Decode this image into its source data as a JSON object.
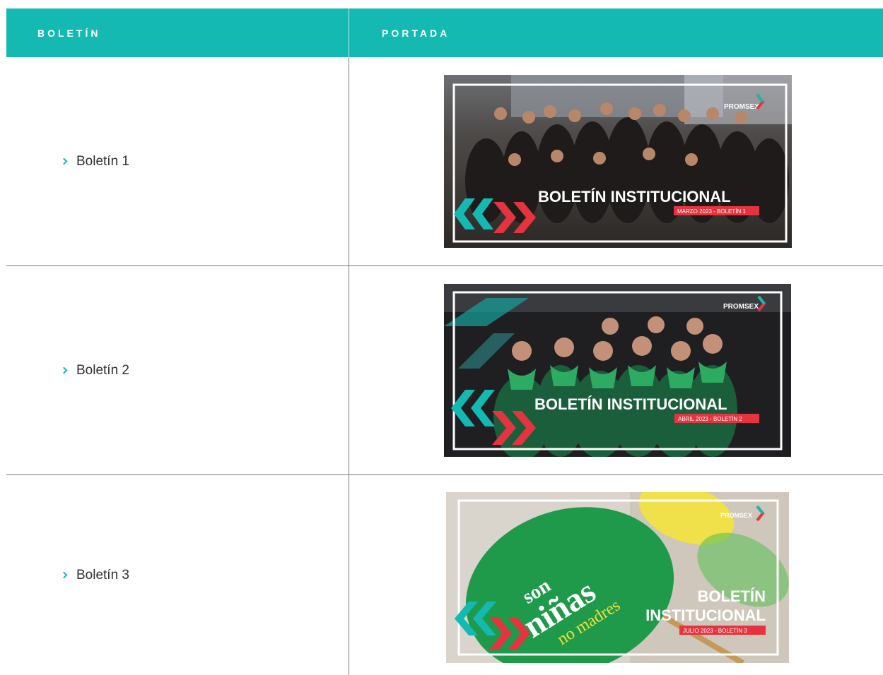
{
  "header": {
    "col1": "BOLETÍN",
    "col2": "PORTADA"
  },
  "colors": {
    "accent": "#14b9b2",
    "red": "#e3343f",
    "text": "#2f2f2f"
  },
  "rows": [
    {
      "label": "Boletín 1",
      "cover": {
        "logo": "PROMSEX",
        "title": "BOLETÍN INSTITUCIONAL",
        "subtitle": "MARZO 2023 - BOLETÍN 1"
      }
    },
    {
      "label": "Boletín 2",
      "cover": {
        "logo": "PROMSEX",
        "title": "BOLETÍN INSTITUCIONAL",
        "subtitle": "ABRIL 2023 - BOLETÍN 2"
      }
    },
    {
      "label": "Boletín 3",
      "cover": {
        "logo": "PROMSEX",
        "title_line1": "BOLETÍN",
        "title_line2": "INSTITUCIONAL",
        "subtitle": "JULIO 2023 - BOLETÍN 3",
        "sign_word1": "son",
        "sign_word2": "niñas",
        "sign_word3": "no madres"
      }
    }
  ]
}
